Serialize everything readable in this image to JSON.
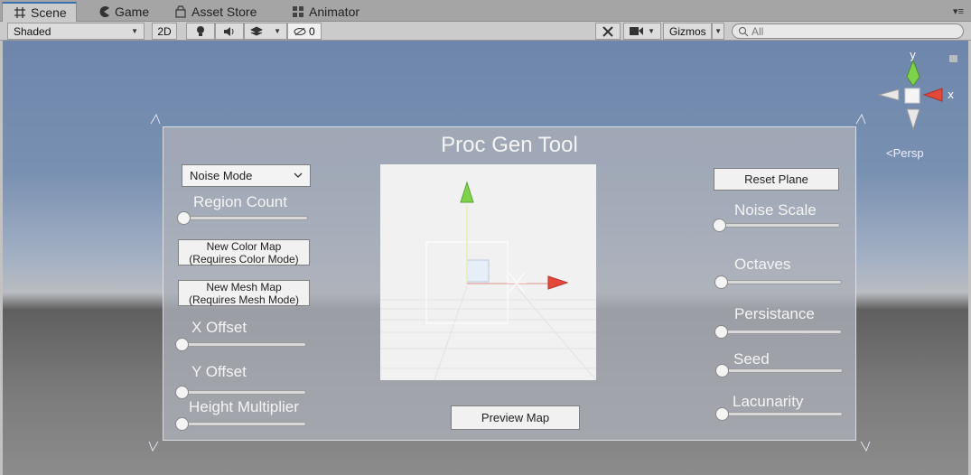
{
  "tabs": [
    {
      "label": "Scene",
      "icon": "grid-icon",
      "active": true
    },
    {
      "label": "Game",
      "icon": "pacman-icon",
      "active": false
    },
    {
      "label": "Asset Store",
      "icon": "store-icon",
      "active": false
    },
    {
      "label": "Animator",
      "icon": "animator-icon",
      "active": false
    }
  ],
  "toolbar": {
    "shading_mode": "Shaded",
    "mode_2d": "2D",
    "hidden_count": "0",
    "gizmos_label": "Gizmos",
    "search_placeholder": "All"
  },
  "viewport": {
    "persp_label": "Persp",
    "axis_x": "x",
    "axis_y": "y"
  },
  "panel": {
    "title": "Proc Gen Tool",
    "noise_mode_dropdown": "Noise Mode",
    "region_count_label": "Region Count",
    "new_color_map_line1": "New Color Map",
    "new_color_map_line2": "(Requires Color Mode)",
    "new_mesh_map_line1": "New Mesh Map",
    "new_mesh_map_line2": "(Requires Mesh Mode)",
    "x_offset_label": "X Offset",
    "y_offset_label": "Y Offset",
    "height_multiplier_label": "Height Multiplier",
    "preview_map_button": "Preview Map",
    "reset_plane_button": "Reset Plane",
    "noise_scale_label": "Noise Scale",
    "octaves_label": "Octaves",
    "persistance_label": "Persistance",
    "seed_label": "Seed",
    "lacunarity_label": "Lacunarity"
  }
}
